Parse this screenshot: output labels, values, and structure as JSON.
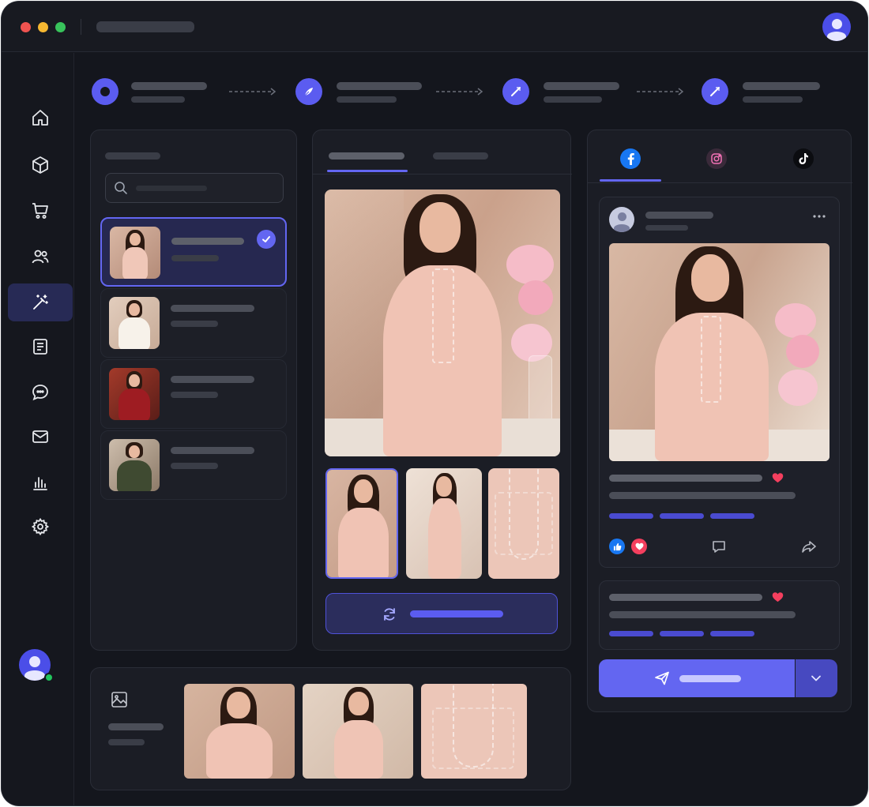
{
  "window": {
    "controls": {
      "close_color": "#ef5350",
      "minimize_color": "#f5b731",
      "maximize_color": "#38c35b"
    }
  },
  "icons": {
    "sidebar": [
      "home-icon",
      "box-icon",
      "cart-icon",
      "users-icon",
      "magic-wand-icon",
      "document-icon",
      "chat-icon",
      "mail-icon",
      "bar-chart-icon",
      "gear-icon"
    ],
    "steps": [
      "circle-dot-icon",
      "feather-pen-icon",
      "feather-pen-icon",
      "feather-pen-icon"
    ],
    "social_tabs": [
      "facebook-icon",
      "instagram-icon",
      "tiktok-icon"
    ]
  },
  "sidebar": {
    "active_index": 4
  },
  "stepper": {
    "step_count": 4,
    "active_step": 0
  },
  "products": {
    "selected_index": 0,
    "count": 4
  },
  "preview_tabs": {
    "active_index": 0
  },
  "social": {
    "active_index": 0
  },
  "colors": {
    "accent": "#6366f1",
    "background": "#14161d",
    "panel": "#1b1d25",
    "heart": "#f43f5e",
    "facebook": "#1877f2"
  }
}
